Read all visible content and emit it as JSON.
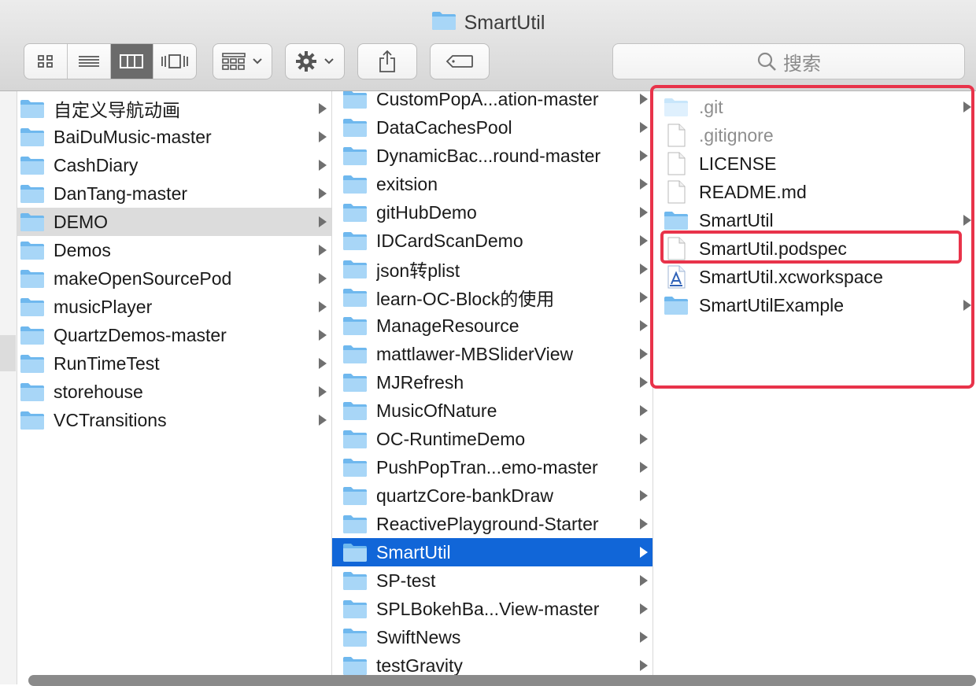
{
  "window": {
    "title": "SmartUtil",
    "title_icon": "folder-icon"
  },
  "toolbar": {
    "view_modes": [
      "icon-view-icon",
      "list-view-icon",
      "column-view-icon",
      "cover-flow-view-icon"
    ],
    "active_view": "column-view-icon",
    "arrange_icon": "arrange-grid-icon",
    "action_icon": "gear-icon",
    "share_icon": "share-icon",
    "tag_icon": "tag-icon",
    "search_placeholder": "搜索"
  },
  "colors": {
    "selection_blue": "#1166d8",
    "selection_gray": "#dcdcdc",
    "folder_light": "#a8d6f7",
    "folder_main": "#6fb8ee",
    "annotation_red": "#e8334a"
  },
  "columns": [
    {
      "items": [
        {
          "name": "自定义导航动画",
          "kind": "folder",
          "has_children": true
        },
        {
          "name": "BaiDuMusic-master",
          "kind": "folder",
          "has_children": true
        },
        {
          "name": "CashDiary",
          "kind": "folder",
          "has_children": true
        },
        {
          "name": "DanTang-master",
          "kind": "folder",
          "has_children": true
        },
        {
          "name": "DEMO",
          "kind": "folder",
          "has_children": true,
          "selected": "gray"
        },
        {
          "name": "Demos",
          "kind": "folder",
          "has_children": true
        },
        {
          "name": "makeOpenSourcePod",
          "kind": "folder",
          "has_children": true
        },
        {
          "name": "musicPlayer",
          "kind": "folder",
          "has_children": true
        },
        {
          "name": "QuartzDemos-master",
          "kind": "folder",
          "has_children": true
        },
        {
          "name": "RunTimeTest",
          "kind": "folder",
          "has_children": true
        },
        {
          "name": "storehouse",
          "kind": "folder",
          "has_children": true
        },
        {
          "name": "VCTransitions",
          "kind": "folder",
          "has_children": true
        }
      ]
    },
    {
      "items": [
        {
          "name": "CustomPopA...ation-master",
          "kind": "folder",
          "has_children": true
        },
        {
          "name": "DataCachesPool",
          "kind": "folder",
          "has_children": true
        },
        {
          "name": "DynamicBac...round-master",
          "kind": "folder",
          "has_children": true
        },
        {
          "name": "exitsion",
          "kind": "folder",
          "has_children": true
        },
        {
          "name": "gitHubDemo",
          "kind": "folder",
          "has_children": true
        },
        {
          "name": "IDCardScanDemo",
          "kind": "folder",
          "has_children": true
        },
        {
          "name": "json转plist",
          "kind": "folder",
          "has_children": true
        },
        {
          "name": "learn-OC-Block的使用",
          "kind": "folder",
          "has_children": true
        },
        {
          "name": "ManageResource",
          "kind": "folder",
          "has_children": true
        },
        {
          "name": "mattlawer-MBSliderView",
          "kind": "folder",
          "has_children": true
        },
        {
          "name": "MJRefresh",
          "kind": "folder",
          "has_children": true
        },
        {
          "name": "MusicOfNature",
          "kind": "folder",
          "has_children": true
        },
        {
          "name": "OC-RuntimeDemo",
          "kind": "folder",
          "has_children": true
        },
        {
          "name": "PushPopTran...emo-master",
          "kind": "folder",
          "has_children": true
        },
        {
          "name": "quartzCore-bankDraw",
          "kind": "folder",
          "has_children": true
        },
        {
          "name": "ReactivePlayground-Starter",
          "kind": "folder",
          "has_children": true
        },
        {
          "name": "SmartUtil",
          "kind": "folder",
          "has_children": true,
          "selected": "blue"
        },
        {
          "name": "SP-test",
          "kind": "folder",
          "has_children": true
        },
        {
          "name": "SPLBokehBa...View-master",
          "kind": "folder",
          "has_children": true
        },
        {
          "name": "SwiftNews",
          "kind": "folder",
          "has_children": true
        },
        {
          "name": "testGravity",
          "kind": "folder",
          "has_children": true
        }
      ]
    },
    {
      "items": [
        {
          "name": ".git",
          "kind": "folder-hidden",
          "has_children": true,
          "dim": true
        },
        {
          "name": ".gitignore",
          "kind": "file",
          "has_children": false,
          "dim": true
        },
        {
          "name": "LICENSE",
          "kind": "file",
          "has_children": false
        },
        {
          "name": "README.md",
          "kind": "file",
          "has_children": false
        },
        {
          "name": "SmartUtil",
          "kind": "folder",
          "has_children": true
        },
        {
          "name": "SmartUtil.podspec",
          "kind": "file",
          "has_children": false,
          "highlighted": true
        },
        {
          "name": "SmartUtil.xcworkspace",
          "kind": "workspace",
          "has_children": false
        },
        {
          "name": "SmartUtilExample",
          "kind": "folder",
          "has_children": true
        }
      ]
    }
  ]
}
